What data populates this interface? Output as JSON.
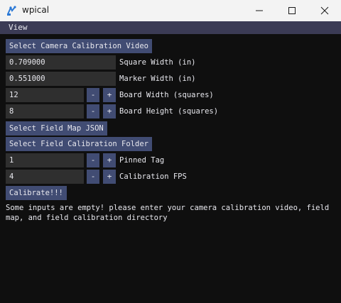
{
  "window": {
    "title": "wpical"
  },
  "menu": {
    "view": "View"
  },
  "buttons": {
    "select_video": "Select Camera Calibration Video",
    "select_field_map": "Select Field Map JSON",
    "select_field_folder": "Select Field Calibration Folder",
    "calibrate": "Calibrate!!!"
  },
  "fields": {
    "square_width": {
      "value": "0.709000",
      "label": "Square Width (in)"
    },
    "marker_width": {
      "value": "0.551000",
      "label": "Marker Width (in)"
    },
    "board_width": {
      "value": "12",
      "label": "Board Width (squares)"
    },
    "board_height": {
      "value": "8",
      "label": "Board Height (squares)"
    },
    "pinned_tag": {
      "value": "1",
      "label": "Pinned Tag"
    },
    "calibration_fps": {
      "value": "4",
      "label": "Calibration FPS"
    }
  },
  "stepper": {
    "minus": "-",
    "plus": "+"
  },
  "message": {
    "line1": "Some inputs are empty! please enter your camera calibration video, field",
    "line2": "map, and field calibration directory"
  },
  "icons": {
    "app": "wpical-app-icon",
    "minimize": "minimize-icon",
    "maximize": "maximize-icon",
    "close": "close-icon"
  },
  "colors": {
    "button": "#414c73",
    "field": "#2f2f2f",
    "menubar": "#3b3b55",
    "background": "#0f0f0f",
    "titlebar": "#f3f3f3"
  }
}
